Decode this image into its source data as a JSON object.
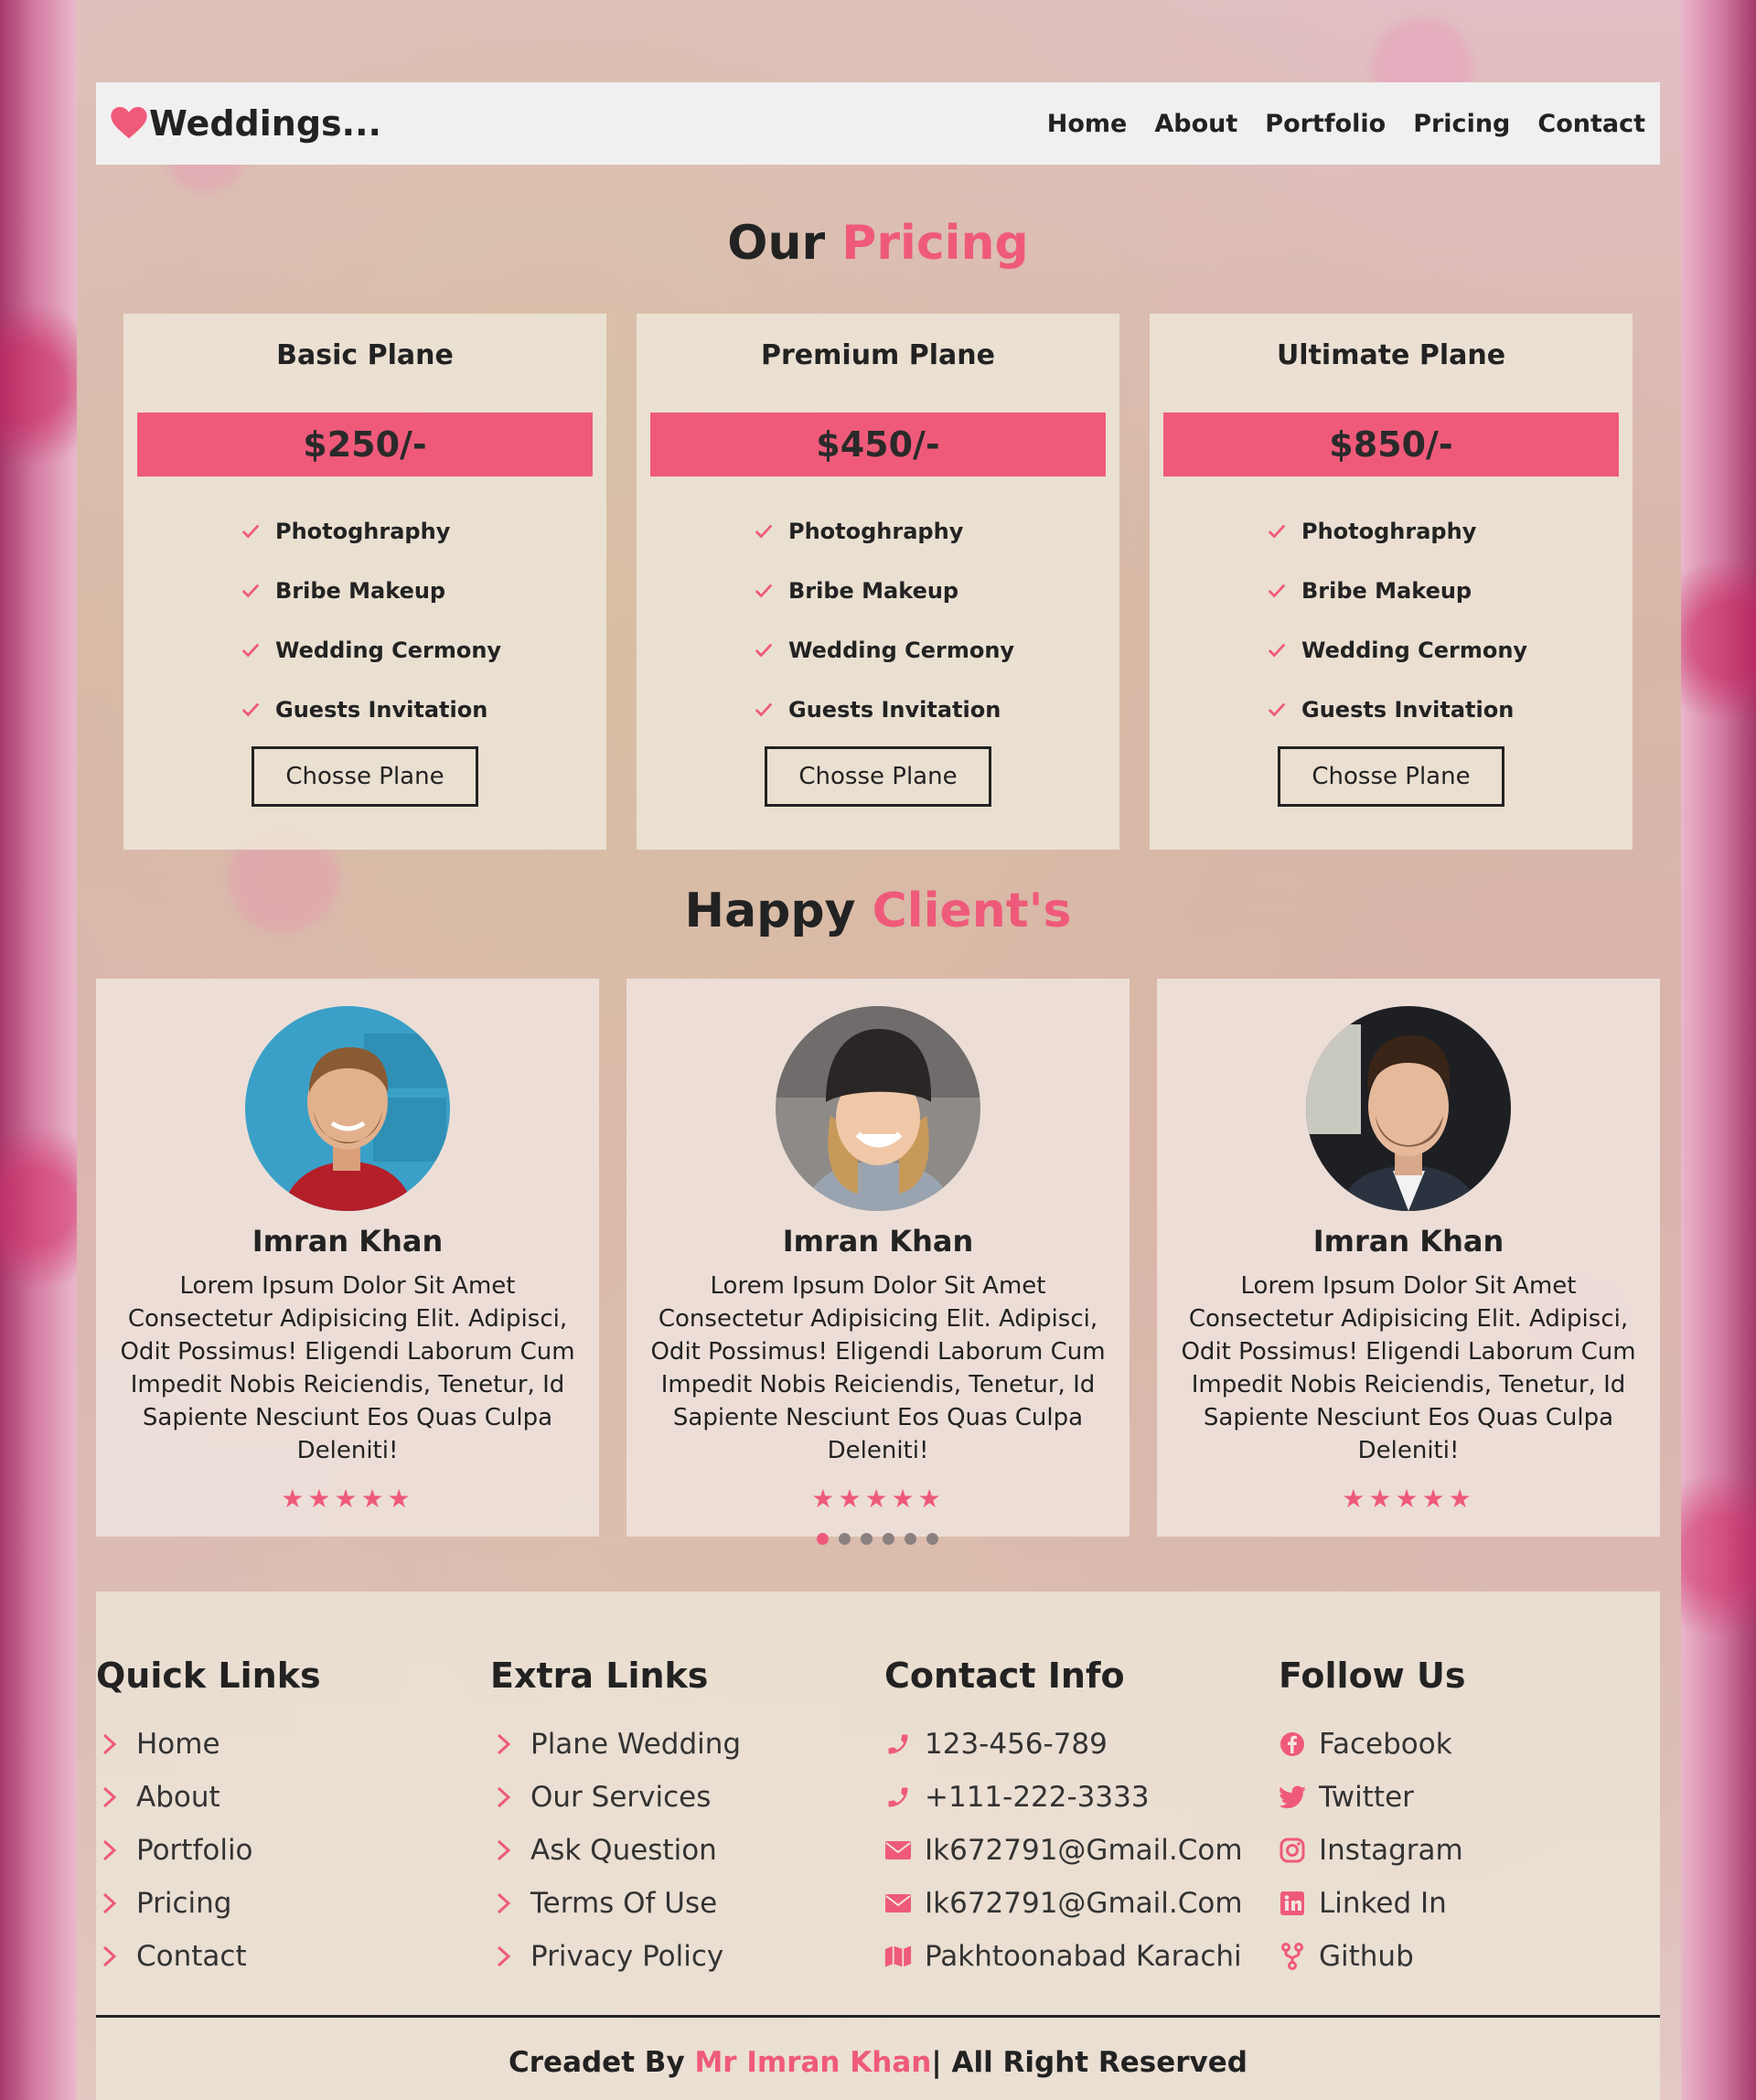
{
  "brand": {
    "name": "Weddings..."
  },
  "nav": {
    "items": [
      "Home",
      "About",
      "Portfolio",
      "Pricing",
      "Contact"
    ]
  },
  "pricing": {
    "heading_main": "Our",
    "heading_accent": "Pricing",
    "plans": [
      {
        "name": "Basic Plane",
        "price": "$250/-",
        "features": [
          "Photoghraphy",
          "Bribe Makeup",
          "Wedding Cermony",
          "Guests Invitation"
        ],
        "button": "Chosse Plane"
      },
      {
        "name": "Premium Plane",
        "price": "$450/-",
        "features": [
          "Photoghraphy",
          "Bribe Makeup",
          "Wedding Cermony",
          "Guests Invitation"
        ],
        "button": "Chosse Plane"
      },
      {
        "name": "Ultimate Plane",
        "price": "$850/-",
        "features": [
          "Photoghraphy",
          "Bribe Makeup",
          "Wedding Cermony",
          "Guests Invitation"
        ],
        "button": "Chosse Plane"
      }
    ]
  },
  "clients": {
    "heading_main": "Happy",
    "heading_accent": "Client's",
    "items": [
      {
        "name": "Imran Khan",
        "text": "Lorem Ipsum Dolor Sit Amet Consectetur Adipisicing Elit. Adipisci, Odit Possimus! Eligendi Laborum Cum Impedit Nobis Reiciendis, Tenetur, Id Sapiente Nesciunt Eos Quas Culpa Deleniti!",
        "rating": 5
      },
      {
        "name": "Imran Khan",
        "text": "Lorem Ipsum Dolor Sit Amet Consectetur Adipisicing Elit. Adipisci, Odit Possimus! Eligendi Laborum Cum Impedit Nobis Reiciendis, Tenetur, Id Sapiente Nesciunt Eos Quas Culpa Deleniti!",
        "rating": 5
      },
      {
        "name": "Imran Khan",
        "text": "Lorem Ipsum Dolor Sit Amet Consectetur Adipisicing Elit. Adipisci, Odit Possimus! Eligendi Laborum Cum Impedit Nobis Reiciendis, Tenetur, Id Sapiente Nesciunt Eos Quas Culpa Deleniti!",
        "rating": 5
      }
    ],
    "slider_dots": 6,
    "active_dot": 0
  },
  "footer": {
    "quick_links": {
      "title": "Quick Links",
      "items": [
        "Home",
        "About",
        "Portfolio",
        "Pricing",
        "Contact"
      ]
    },
    "extra_links": {
      "title": "Extra Links",
      "items": [
        "Plane Wedding",
        "Our Services",
        "Ask Question",
        "Terms Of Use",
        "Privacy Policy"
      ]
    },
    "contact_info": {
      "title": "Contact Info",
      "items": [
        {
          "icon": "phone-icon",
          "text": "123-456-789"
        },
        {
          "icon": "phone-icon",
          "text": "+111-222-3333"
        },
        {
          "icon": "envelope-icon",
          "text": "Ik672791@Gmail.Com"
        },
        {
          "icon": "envelope-icon",
          "text": "Ik672791@Gmail.Com"
        },
        {
          "icon": "map-icon",
          "text": "Pakhtoonabad Karachi"
        }
      ]
    },
    "follow_us": {
      "title": "Follow Us",
      "items": [
        {
          "icon": "facebook-icon",
          "text": "Facebook"
        },
        {
          "icon": "twitter-icon",
          "text": "Twitter"
        },
        {
          "icon": "instagram-icon",
          "text": "Instagram"
        },
        {
          "icon": "linkedin-icon",
          "text": "Linked In"
        },
        {
          "icon": "github-icon",
          "text": "Github"
        }
      ]
    },
    "credits": {
      "prefix": "Creadet By",
      "author": "Mr Imran Khan",
      "suffix": "| All Right Reserved"
    }
  },
  "colors": {
    "accent": "#ef5a7a",
    "text": "#222222",
    "nav_bg": "#f1f0f0"
  }
}
